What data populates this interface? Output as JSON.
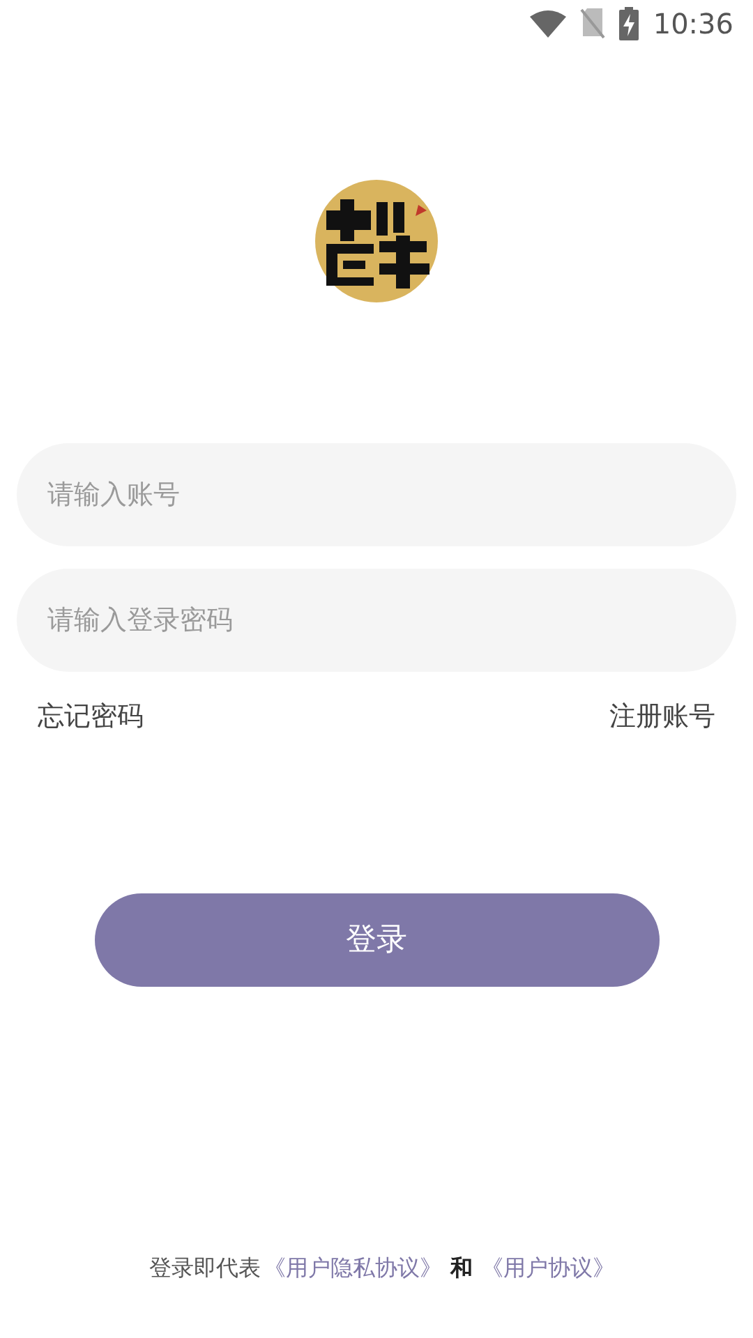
{
  "status_bar": {
    "time": "10:36"
  },
  "account_field": {
    "placeholder": "请输入账号"
  },
  "password_field": {
    "placeholder": "请输入登录密码"
  },
  "links": [
    {
      "label": "忘记密码"
    },
    {
      "label": "注册账号"
    }
  ],
  "login_button": {
    "label": "登录"
  },
  "agreement": [
    {
      "kind": "text",
      "text": "登录即代表"
    },
    {
      "kind": "link",
      "text": "《用户隐私协议》"
    },
    {
      "kind": "bold",
      "text": "和"
    },
    {
      "kind": "link",
      "text": "《用户协议》"
    }
  ]
}
